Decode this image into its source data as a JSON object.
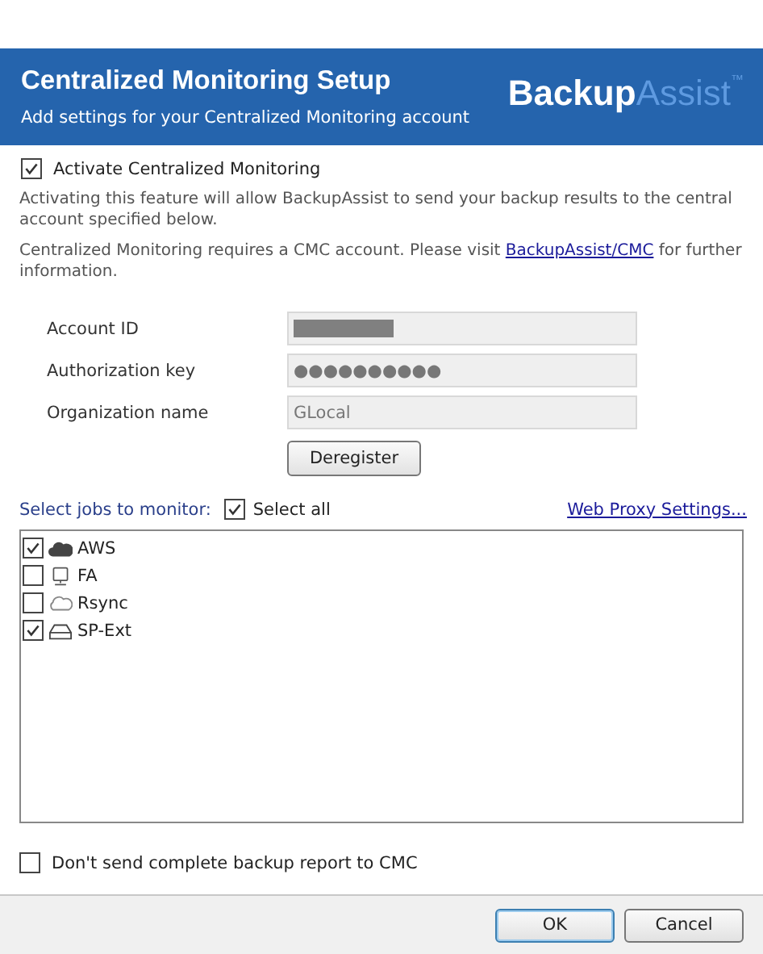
{
  "header": {
    "title": "Centralized Monitoring Setup",
    "subtitle": "Add settings for your Centralized Monitoring account",
    "logo": {
      "first": "Backup",
      "second": "Assist",
      "mark": "™"
    }
  },
  "activate": {
    "label": "Activate Centralized Monitoring",
    "checked": true
  },
  "info": [
    "Activating this feature will allow BackupAssist to send your backup results to the central account specified below."
  ],
  "cmc_note": {
    "before": "Centralized Monitoring requires a CMC account. Please visit",
    "link": "BackupAssist/CMC",
    "after": "for further information."
  },
  "fields": [
    {
      "label": "Account ID",
      "kind": "redacted"
    },
    {
      "label": "Authorization key",
      "kind": "text",
      "value": "●●●●●●●●●●"
    },
    {
      "label": "Organization name",
      "kind": "text",
      "value": "GLocal"
    }
  ],
  "deregister": "Deregister",
  "jobs_label": "Select jobs to monitor:",
  "select_all": {
    "label": "Select all",
    "checked": true
  },
  "proxy_link": "Web Proxy Settings...",
  "jobs": [
    {
      "name": "AWS",
      "kind": "cloud",
      "checked": true
    },
    {
      "name": "FA",
      "kind": "monitor",
      "checked": false
    },
    {
      "name": "Rsync",
      "kind": "sync-cloud",
      "checked": false
    },
    {
      "name": "SP-Ext",
      "kind": "drive",
      "checked": true
    }
  ],
  "no_report": {
    "label": "Don't send complete backup report to CMC",
    "checked": false
  },
  "buttons": [
    "OK",
    "Cancel"
  ]
}
